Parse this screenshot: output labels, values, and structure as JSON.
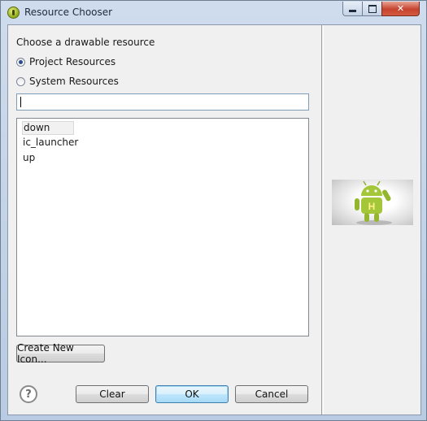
{
  "window": {
    "title": "Resource Chooser"
  },
  "titlebar_buttons": {
    "close": "✕"
  },
  "form": {
    "prompt": "Choose a drawable resource",
    "radio_project": "Project Resources",
    "radio_system": "System Resources",
    "selected_radio": "Project Resources",
    "filter_value": ""
  },
  "resources": [
    "down",
    "ic_launcher",
    "up"
  ],
  "selected_resource": "down",
  "buttons": {
    "create_new_icon": "Create New Icon...",
    "clear": "Clear",
    "ok": "OK",
    "cancel": "Cancel",
    "help": "?"
  },
  "preview": {
    "letter": "H",
    "icon": "android-robot-icon"
  },
  "colors": {
    "android_green": "#a4c639",
    "accent_blue": "#3c7fb1"
  }
}
